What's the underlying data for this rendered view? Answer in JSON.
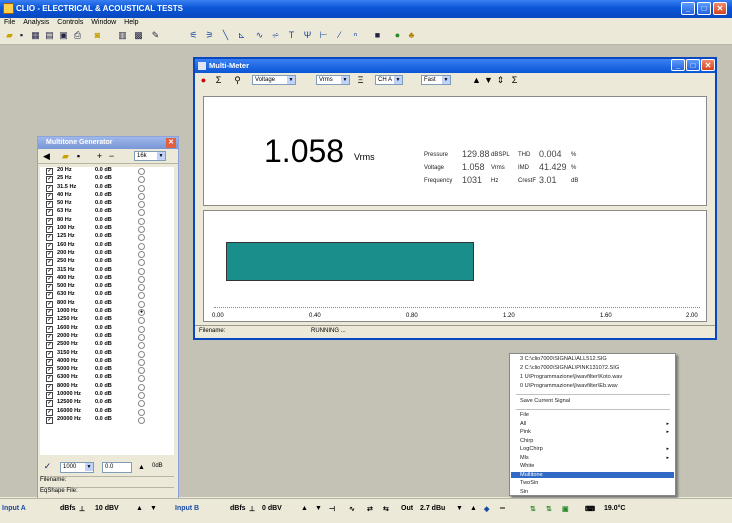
{
  "app": {
    "title": "CLIO - ELECTRICAL & ACOUSTICAL TESTS"
  },
  "menu": [
    "File",
    "Analysis",
    "Controls",
    "Window",
    "Help"
  ],
  "multimeter": {
    "title": "Multi-Meter",
    "mode_select": "Voltage",
    "unit_select": "Vrms",
    "channel_select": "CH A",
    "speed_select": "Fast",
    "main_value": "1.058",
    "main_unit": "Vrms",
    "readings": [
      {
        "label": "Pressure",
        "value": "129.88",
        "unit": "dBSPL"
      },
      {
        "label": "Voltage",
        "value": "1.058",
        "unit": "Vrms"
      },
      {
        "label": "Frequency",
        "value": "1031",
        "unit": "Hz"
      }
    ],
    "readings2": [
      {
        "label": "THD",
        "value": "0.004",
        "unit": "%"
      },
      {
        "label": "IMD",
        "value": "41.429",
        "unit": "%"
      },
      {
        "label": "CrestF",
        "value": "3.01",
        "unit": "dB"
      }
    ],
    "bar_level": 1.058,
    "bar_scale_max": 2.0,
    "ticks": [
      "0.00",
      "0.40",
      "0.80",
      "1.20",
      "1.60",
      "2.00"
    ],
    "status_filename_label": "Filename:",
    "status_state": "RUNNING ..."
  },
  "multitone": {
    "title": "Multitone Generator",
    "top_select": "16k",
    "rows": [
      {
        "freq": "20 Hz",
        "level": "0.0 dB",
        "ref": false
      },
      {
        "freq": "25 Hz",
        "level": "0.0 dB",
        "ref": false
      },
      {
        "freq": "31.5 Hz",
        "level": "0.0 dB",
        "ref": false
      },
      {
        "freq": "40 Hz",
        "level": "0.0 dB",
        "ref": false
      },
      {
        "freq": "50 Hz",
        "level": "0.0 dB",
        "ref": false
      },
      {
        "freq": "63 Hz",
        "level": "0.0 dB",
        "ref": false
      },
      {
        "freq": "80 Hz",
        "level": "0.0 dB",
        "ref": false
      },
      {
        "freq": "100 Hz",
        "level": "0.0 dB",
        "ref": false
      },
      {
        "freq": "125 Hz",
        "level": "0.0 dB",
        "ref": false
      },
      {
        "freq": "160 Hz",
        "level": "0.0 dB",
        "ref": false
      },
      {
        "freq": "200 Hz",
        "level": "0.0 dB",
        "ref": false
      },
      {
        "freq": "250 Hz",
        "level": "0.0 dB",
        "ref": false
      },
      {
        "freq": "315 Hz",
        "level": "0.0 dB",
        "ref": false
      },
      {
        "freq": "400 Hz",
        "level": "0.0 dB",
        "ref": false
      },
      {
        "freq": "500 Hz",
        "level": "0.0 dB",
        "ref": false
      },
      {
        "freq": "630 Hz",
        "level": "0.0 dB",
        "ref": false
      },
      {
        "freq": "800 Hz",
        "level": "0.0 dB",
        "ref": false
      },
      {
        "freq": "1000 Hz",
        "level": "0.0 dB",
        "ref": true
      },
      {
        "freq": "1250 Hz",
        "level": "0.0 dB",
        "ref": false
      },
      {
        "freq": "1600 Hz",
        "level": "0.0 dB",
        "ref": false
      },
      {
        "freq": "2000 Hz",
        "level": "0.0 dB",
        "ref": false
      },
      {
        "freq": "2500 Hz",
        "level": "0.0 dB",
        "ref": false
      },
      {
        "freq": "3150 Hz",
        "level": "0.0 dB",
        "ref": false
      },
      {
        "freq": "4000 Hz",
        "level": "0.0 dB",
        "ref": false
      },
      {
        "freq": "5000 Hz",
        "level": "0.0 dB",
        "ref": false
      },
      {
        "freq": "6300 Hz",
        "level": "0.0 dB",
        "ref": false
      },
      {
        "freq": "8000 Hz",
        "level": "0.0 dB",
        "ref": false
      },
      {
        "freq": "10000 Hz",
        "level": "0.0 dB",
        "ref": false
      },
      {
        "freq": "12500 Hz",
        "level": "0.0 dB",
        "ref": false
      },
      {
        "freq": "16000 Hz",
        "level": "0.0 dB",
        "ref": false
      },
      {
        "freq": "20000 Hz",
        "level": "0.0 dB",
        "ref": false
      }
    ],
    "footer_freq": "1000",
    "footer_level": "0.0",
    "footer_unit": "0dB",
    "filename_label": "Filename:",
    "eqshape_label": "EqShape File:"
  },
  "context_menu": {
    "recent": [
      "3 C:\\clio7000\\SIGNAL\\ALL512.SIG",
      "2 C:\\clio7000\\SIGNAL\\PINK131072.SIG",
      "1 U\\Programmazione\\j\\wavfilter\\Koto.wav",
      "0 U\\Programmazione\\j\\wavfilter\\Eb.wav"
    ],
    "save": "Save Current Signal",
    "items": [
      {
        "label": "File",
        "submenu": false
      },
      {
        "label": "All",
        "submenu": true
      },
      {
        "label": "Pink",
        "submenu": true
      },
      {
        "label": "Chirp",
        "submenu": false
      },
      {
        "label": "LogChirp",
        "submenu": true
      },
      {
        "label": "Mls",
        "submenu": true
      },
      {
        "label": "White",
        "submenu": false
      },
      {
        "label": "Multitone",
        "submenu": false
      },
      {
        "label": "TwoSin",
        "submenu": false
      },
      {
        "label": "Sin",
        "submenu": false
      }
    ],
    "highlighted": "Multitone"
  },
  "statusbar": {
    "input_a": "Input A",
    "a_unit": "dBfs",
    "a_range": "10 dBV",
    "input_b": "Input B",
    "b_unit": "dBfs",
    "b_range": "0 dBV",
    "out_label": "Out",
    "out_level": "2.7 dBu",
    "temp": "19.0°C"
  },
  "colors": {
    "bar": "#1a8e8a",
    "titlebar": "#0a55d6",
    "highlight": "#316ac5"
  }
}
